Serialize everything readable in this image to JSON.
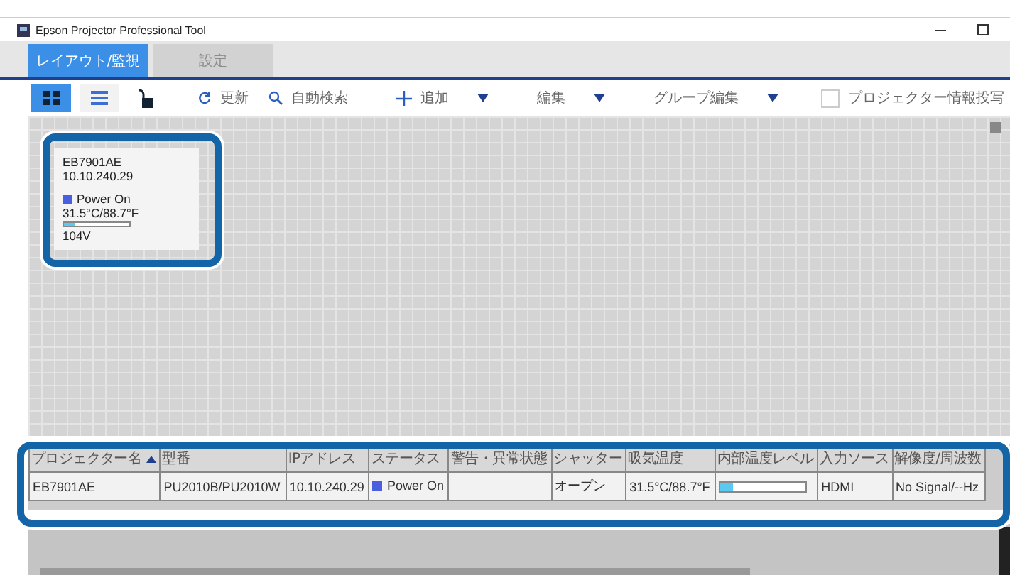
{
  "window": {
    "title": "Epson Projector Professional Tool"
  },
  "tabs": [
    {
      "label": "レイアウト/監視",
      "selected": true,
      "disabled": false
    },
    {
      "label": "設定",
      "selected": false,
      "disabled": true
    }
  ],
  "toolbar": {
    "views": [
      {
        "kind": "layout",
        "selected": true
      },
      {
        "kind": "list",
        "selected": false
      }
    ],
    "locked": false,
    "actions": [
      {
        "kind": "refresh",
        "label": "更新"
      },
      {
        "kind": "search",
        "label": "自動検索"
      },
      {
        "kind": "add",
        "label": "追加"
      },
      {
        "kind": "menu",
        "label": "編集"
      },
      {
        "kind": "menu",
        "label": "グループ編集"
      },
      {
        "kind": "checkbox",
        "label": "プロジェクター情報投写",
        "checked": false
      }
    ]
  },
  "card": {
    "name": "EB7901AE",
    "ip": "10.10.240.29",
    "status": {
      "text": "Power On",
      "color": "#4a5fe0"
    },
    "temperature": "31.5°C/88.7°F",
    "level": 0.18,
    "voltage": "104V"
  },
  "table": {
    "columns": [
      {
        "label": "プロジェクター名",
        "sorted": true
      },
      {
        "label": "型番",
        "sorted": false
      },
      {
        "label": "IPアドレス",
        "sorted": false
      },
      {
        "label": "ステータス",
        "sorted": false
      },
      {
        "label": "警告・異常状態",
        "sorted": false
      },
      {
        "label": "シャッター",
        "sorted": false
      },
      {
        "label": "吸気温度",
        "sorted": false
      },
      {
        "label": "内部温度レベル",
        "sorted": false
      },
      {
        "label": "入力ソース",
        "sorted": false
      },
      {
        "label": "解像度/周波数",
        "sorted": false
      }
    ],
    "rows": [
      {
        "cells": [
          {
            "kind": "text",
            "text": "EB7901AE"
          },
          {
            "kind": "text",
            "text": "PU2010B/PU2010W"
          },
          {
            "kind": "text",
            "text": "10.10.240.29"
          },
          {
            "kind": "status",
            "text": "Power On",
            "color": "#4a5fe0"
          },
          {
            "kind": "empty"
          },
          {
            "kind": "text",
            "text": "オープン"
          },
          {
            "kind": "text",
            "text": "31.5°C/88.7°F"
          },
          {
            "kind": "level",
            "level": 0.15
          },
          {
            "kind": "text",
            "text": "HDMI"
          },
          {
            "kind": "text",
            "text": "No Signal/--Hz"
          }
        ]
      }
    ]
  }
}
